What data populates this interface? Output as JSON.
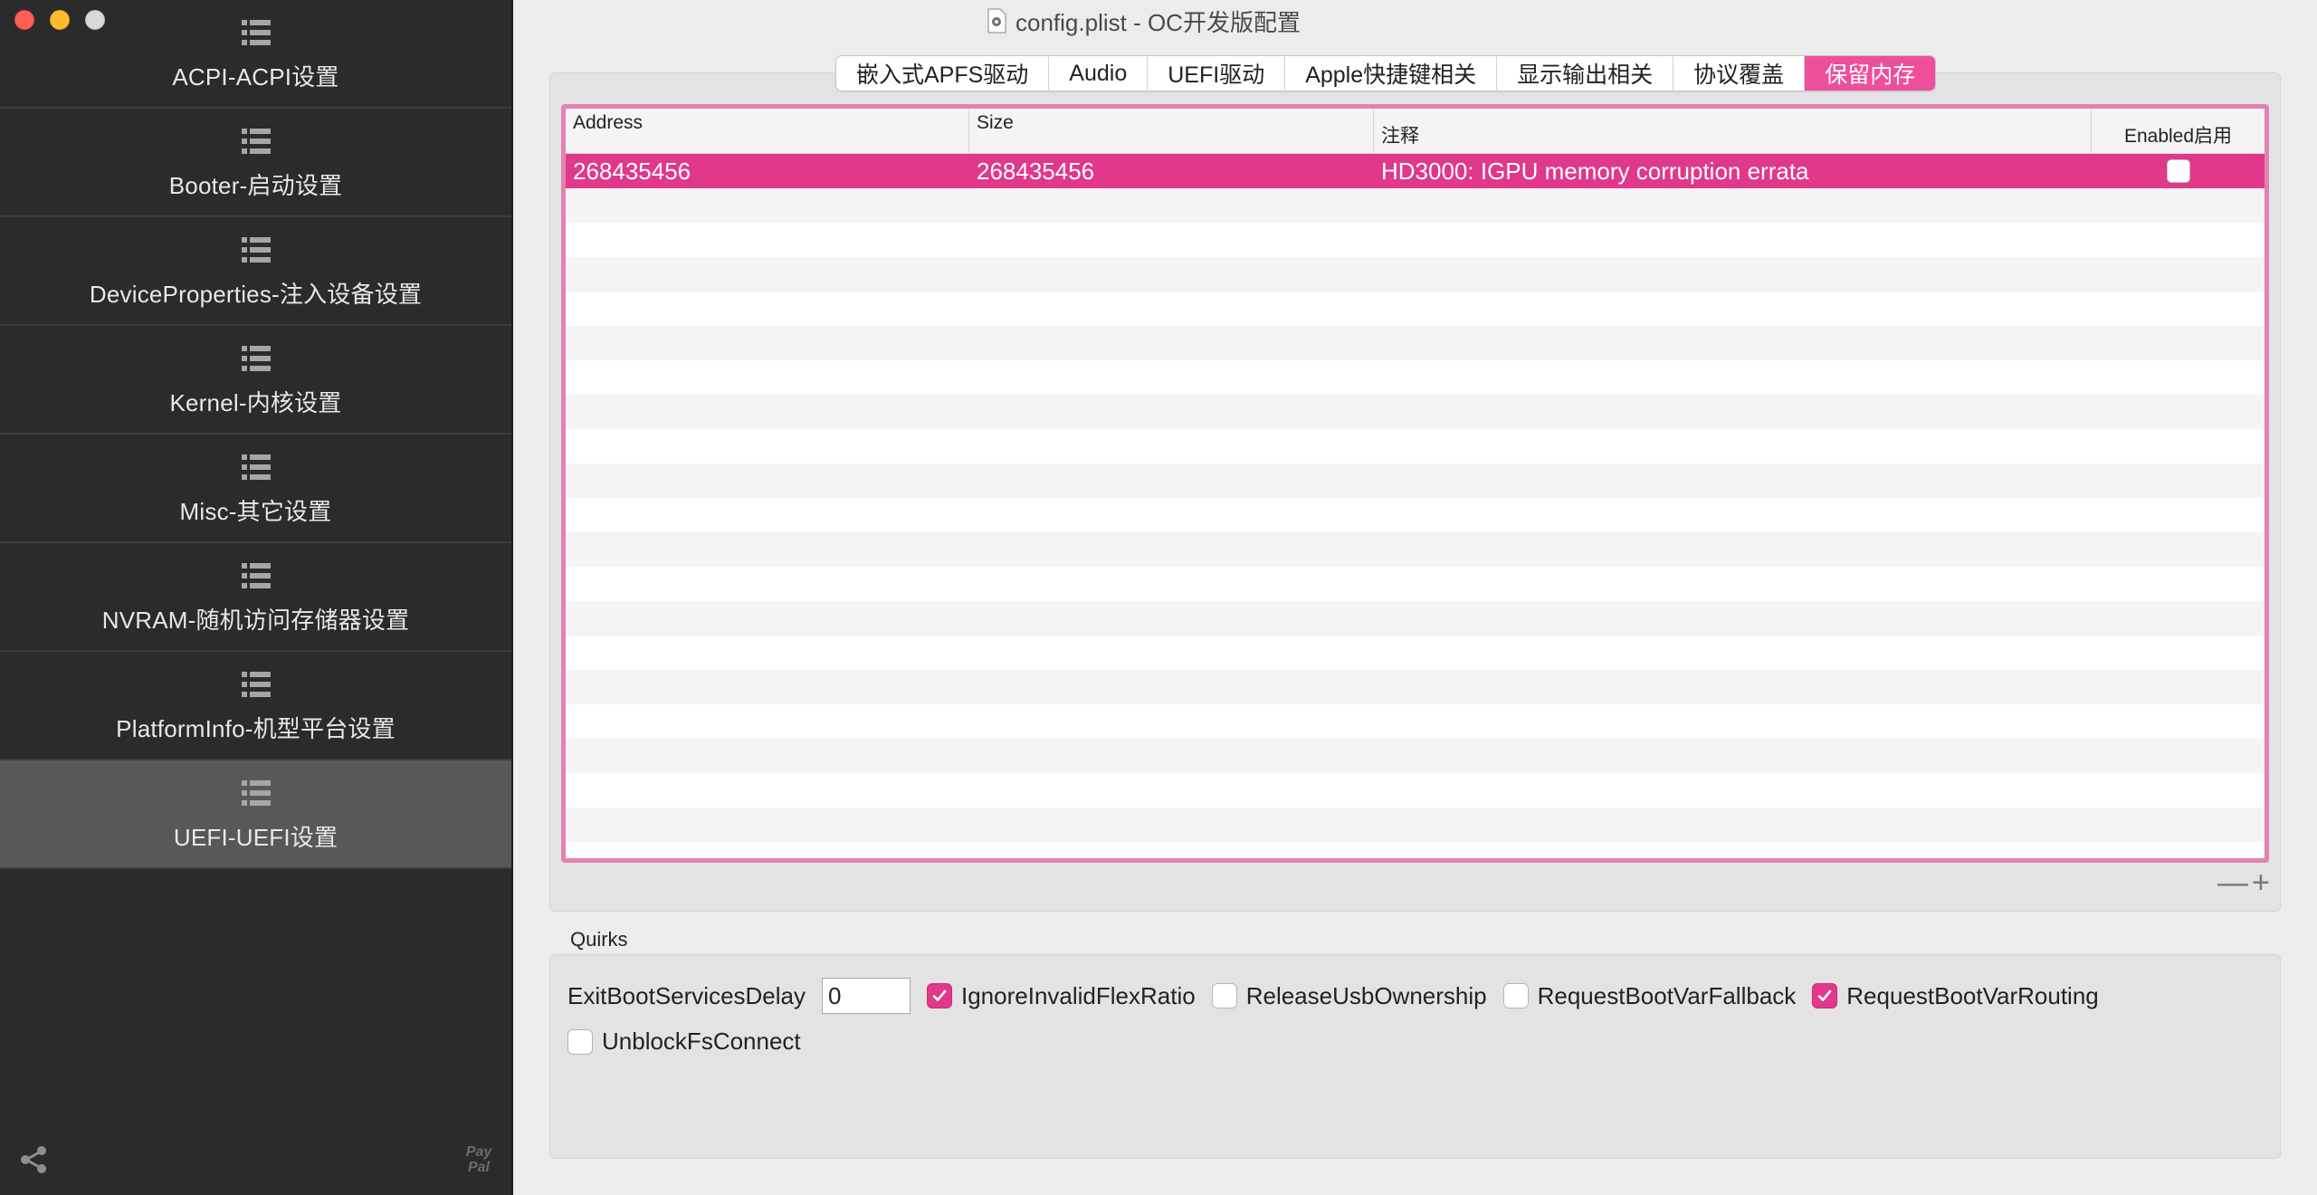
{
  "window": {
    "title": "config.plist - OC开发版配置"
  },
  "sidebar": {
    "items": [
      {
        "label": "ACPI-ACPI设置",
        "active": false
      },
      {
        "label": "Booter-启动设置",
        "active": false
      },
      {
        "label": "DeviceProperties-注入设备设置",
        "active": false
      },
      {
        "label": "Kernel-内核设置",
        "active": false
      },
      {
        "label": "Misc-其它设置",
        "active": false
      },
      {
        "label": "NVRAM-随机访问存储器设置",
        "active": false
      },
      {
        "label": "PlatformInfo-机型平台设置",
        "active": false
      },
      {
        "label": "UEFI-UEFI设置",
        "active": true
      }
    ],
    "paypal": "Pay Pal"
  },
  "tabs": [
    {
      "label": "嵌入式APFS驱动",
      "active": false
    },
    {
      "label": "Audio",
      "active": false
    },
    {
      "label": "UEFI驱动",
      "active": false
    },
    {
      "label": "Apple快捷键相关",
      "active": false
    },
    {
      "label": "显示输出相关",
      "active": false
    },
    {
      "label": "协议覆盖",
      "active": false
    },
    {
      "label": "保留内存",
      "active": true
    }
  ],
  "table": {
    "headers": {
      "address": "Address",
      "size": "Size",
      "comment": "注释",
      "enabled": "Enabled启用"
    },
    "rows": [
      {
        "address": "268435456",
        "size": "268435456",
        "comment": "HD3000: IGPU memory corruption errata",
        "enabled": false,
        "selected": true
      }
    ]
  },
  "table_controls": {
    "remove": "—",
    "add": "+"
  },
  "quirks": {
    "title": "Quirks",
    "exit_boot_services_delay": {
      "label": "ExitBootServicesDelay",
      "value": "0"
    },
    "checkboxes": [
      {
        "label": "IgnoreInvalidFlexRatio",
        "checked": true
      },
      {
        "label": "ReleaseUsbOwnership",
        "checked": false
      },
      {
        "label": "RequestBootVarFallback",
        "checked": false
      },
      {
        "label": "RequestBootVarRouting",
        "checked": true
      },
      {
        "label": "UnblockFsConnect",
        "checked": false
      }
    ]
  },
  "colors": {
    "accent": "#e0388b",
    "sidebar_bg": "#2b2b2d",
    "sidebar_active": "#58585a"
  }
}
